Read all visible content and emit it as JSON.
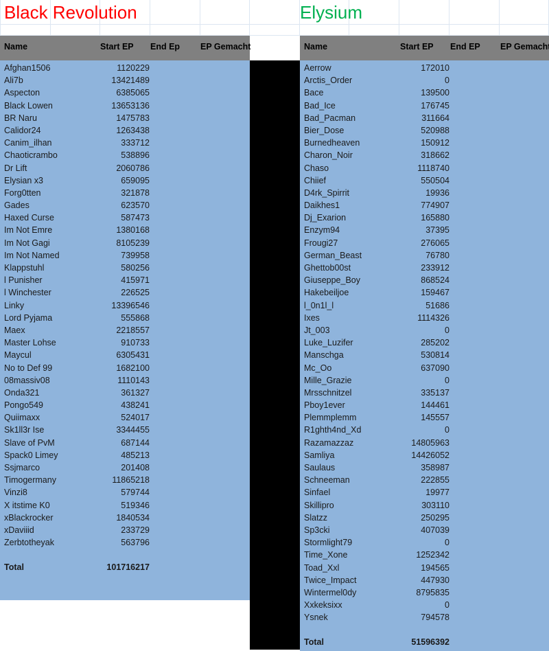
{
  "sheet": {
    "left_table": {
      "title": "Black Revolution",
      "title_color": "#ff0000",
      "columns": {
        "name": "Name",
        "start_ep": "Start EP",
        "end_ep": "End Ep",
        "ep_gemacht": "EP Gemacht"
      },
      "rows": [
        {
          "name": "Afghan1506",
          "start_ep": "1120229",
          "end_ep": "",
          "ep_gemacht": ""
        },
        {
          "name": "Ali7b",
          "start_ep": "13421489",
          "end_ep": "",
          "ep_gemacht": ""
        },
        {
          "name": "Aspecton",
          "start_ep": "6385065",
          "end_ep": "",
          "ep_gemacht": ""
        },
        {
          "name": "Black Lowen",
          "start_ep": "13653136",
          "end_ep": "",
          "ep_gemacht": ""
        },
        {
          "name": "BR Naru",
          "start_ep": "1475783",
          "end_ep": "",
          "ep_gemacht": ""
        },
        {
          "name": "Calidor24",
          "start_ep": "1263438",
          "end_ep": "",
          "ep_gemacht": ""
        },
        {
          "name": "Canim_ilhan",
          "start_ep": "333712",
          "end_ep": "",
          "ep_gemacht": ""
        },
        {
          "name": "Chaoticrambo",
          "start_ep": "538896",
          "end_ep": "",
          "ep_gemacht": ""
        },
        {
          "name": "Dr Lift",
          "start_ep": "2060786",
          "end_ep": "",
          "ep_gemacht": ""
        },
        {
          "name": "Elysian x3",
          "start_ep": "659095",
          "end_ep": "",
          "ep_gemacht": ""
        },
        {
          "name": "Forg0tten",
          "start_ep": "321878",
          "end_ep": "",
          "ep_gemacht": ""
        },
        {
          "name": "Gades",
          "start_ep": "623570",
          "end_ep": "",
          "ep_gemacht": ""
        },
        {
          "name": "Haxed Curse",
          "start_ep": "587473",
          "end_ep": "",
          "ep_gemacht": ""
        },
        {
          "name": "Im Not Emre",
          "start_ep": "1380168",
          "end_ep": "",
          "ep_gemacht": ""
        },
        {
          "name": "Im Not Gagi",
          "start_ep": "8105239",
          "end_ep": "",
          "ep_gemacht": ""
        },
        {
          "name": "Im Not Named",
          "start_ep": "739958",
          "end_ep": "",
          "ep_gemacht": ""
        },
        {
          "name": "Klappstuhl",
          "start_ep": "580256",
          "end_ep": "",
          "ep_gemacht": ""
        },
        {
          "name": "l Punisher",
          "start_ep": "415971",
          "end_ep": "",
          "ep_gemacht": ""
        },
        {
          "name": "l Winchester",
          "start_ep": "226525",
          "end_ep": "",
          "ep_gemacht": ""
        },
        {
          "name": "Linky",
          "start_ep": "13396546",
          "end_ep": "",
          "ep_gemacht": ""
        },
        {
          "name": "Lord Pyjama",
          "start_ep": "555868",
          "end_ep": "",
          "ep_gemacht": ""
        },
        {
          "name": "Maex",
          "start_ep": "2218557",
          "end_ep": "",
          "ep_gemacht": ""
        },
        {
          "name": "Master Lohse",
          "start_ep": "910733",
          "end_ep": "",
          "ep_gemacht": ""
        },
        {
          "name": "Maycul",
          "start_ep": "6305431",
          "end_ep": "",
          "ep_gemacht": ""
        },
        {
          "name": "No to Def 99",
          "start_ep": "1682100",
          "end_ep": "",
          "ep_gemacht": ""
        },
        {
          "name": "08massiv08",
          "start_ep": "1110143",
          "end_ep": "",
          "ep_gemacht": ""
        },
        {
          "name": "Onda321",
          "start_ep": "361327",
          "end_ep": "",
          "ep_gemacht": ""
        },
        {
          "name": "Pongo549",
          "start_ep": "438241",
          "end_ep": "",
          "ep_gemacht": ""
        },
        {
          "name": "Quiimaxx",
          "start_ep": "524017",
          "end_ep": "",
          "ep_gemacht": ""
        },
        {
          "name": "Sk1ll3r Ise",
          "start_ep": "3344455",
          "end_ep": "",
          "ep_gemacht": ""
        },
        {
          "name": "Slave of PvM",
          "start_ep": "687144",
          "end_ep": "",
          "ep_gemacht": ""
        },
        {
          "name": "Spack0 Limey",
          "start_ep": "485213",
          "end_ep": "",
          "ep_gemacht": ""
        },
        {
          "name": "Ssjmarco",
          "start_ep": "201408",
          "end_ep": "",
          "ep_gemacht": ""
        },
        {
          "name": "Timogermany",
          "start_ep": "11865218",
          "end_ep": "",
          "ep_gemacht": ""
        },
        {
          "name": "Vinzi8",
          "start_ep": "579744",
          "end_ep": "",
          "ep_gemacht": ""
        },
        {
          "name": "X itstime K0",
          "start_ep": "519346",
          "end_ep": "",
          "ep_gemacht": ""
        },
        {
          "name": "xBlackrocker",
          "start_ep": "1840534",
          "end_ep": "",
          "ep_gemacht": ""
        },
        {
          "name": "xDaviiid",
          "start_ep": "233729",
          "end_ep": "",
          "ep_gemacht": ""
        },
        {
          "name": "Zerbtotheyak",
          "start_ep": "563796",
          "end_ep": "",
          "ep_gemacht": ""
        }
      ],
      "total": {
        "name": "Total",
        "start_ep": "101716217",
        "end_ep": "",
        "ep_gemacht": ""
      }
    },
    "right_table": {
      "title": "Elysium",
      "title_color": "#00b050",
      "columns": {
        "name": "Name",
        "start_ep": "Start EP",
        "end_ep": "End EP",
        "ep_gemacht": "EP Gemacht"
      },
      "rows": [
        {
          "name": "Aerrow",
          "start_ep": "172010",
          "end_ep": "",
          "ep_gemacht": ""
        },
        {
          "name": "Arctis_Order",
          "start_ep": "0",
          "end_ep": "",
          "ep_gemacht": ""
        },
        {
          "name": "Bace",
          "start_ep": "139500",
          "end_ep": "",
          "ep_gemacht": ""
        },
        {
          "name": "Bad_Ice",
          "start_ep": "176745",
          "end_ep": "",
          "ep_gemacht": ""
        },
        {
          "name": "Bad_Pacman",
          "start_ep": "311664",
          "end_ep": "",
          "ep_gemacht": ""
        },
        {
          "name": "Bier_Dose",
          "start_ep": "520988",
          "end_ep": "",
          "ep_gemacht": ""
        },
        {
          "name": "Burnedheaven",
          "start_ep": "150912",
          "end_ep": "",
          "ep_gemacht": ""
        },
        {
          "name": "Charon_Noir",
          "start_ep": "318662",
          "end_ep": "",
          "ep_gemacht": ""
        },
        {
          "name": "Chaso",
          "start_ep": "1118740",
          "end_ep": "",
          "ep_gemacht": ""
        },
        {
          "name": "Chiief",
          "start_ep": "550504",
          "end_ep": "",
          "ep_gemacht": ""
        },
        {
          "name": "D4rk_Spirrit",
          "start_ep": "19936",
          "end_ep": "",
          "ep_gemacht": ""
        },
        {
          "name": "Daikhes1",
          "start_ep": "774907",
          "end_ep": "",
          "ep_gemacht": ""
        },
        {
          "name": "Dj_Exarion",
          "start_ep": "165880",
          "end_ep": "",
          "ep_gemacht": ""
        },
        {
          "name": "Enzym94",
          "start_ep": "37395",
          "end_ep": "",
          "ep_gemacht": ""
        },
        {
          "name": "Frougi27",
          "start_ep": "276065",
          "end_ep": "",
          "ep_gemacht": ""
        },
        {
          "name": "German_Beast",
          "start_ep": "76780",
          "end_ep": "",
          "ep_gemacht": ""
        },
        {
          "name": "Ghettob00st",
          "start_ep": "233912",
          "end_ep": "",
          "ep_gemacht": ""
        },
        {
          "name": "Giuseppe_Boy",
          "start_ep": "868524",
          "end_ep": "",
          "ep_gemacht": ""
        },
        {
          "name": "Hakebeiljoe",
          "start_ep": "159467",
          "end_ep": "",
          "ep_gemacht": ""
        },
        {
          "name": "l_0n1l_l",
          "start_ep": "51686",
          "end_ep": "",
          "ep_gemacht": ""
        },
        {
          "name": "Ixes",
          "start_ep": "1114326",
          "end_ep": "",
          "ep_gemacht": ""
        },
        {
          "name": "Jt_003",
          "start_ep": "0",
          "end_ep": "",
          "ep_gemacht": ""
        },
        {
          "name": "Luke_Luzifer",
          "start_ep": "285202",
          "end_ep": "",
          "ep_gemacht": ""
        },
        {
          "name": "Manschga",
          "start_ep": "530814",
          "end_ep": "",
          "ep_gemacht": ""
        },
        {
          "name": "Mc_Oo",
          "start_ep": "637090",
          "end_ep": "",
          "ep_gemacht": ""
        },
        {
          "name": "Mille_Grazie",
          "start_ep": "0",
          "end_ep": "",
          "ep_gemacht": ""
        },
        {
          "name": "Mrsschnitzel",
          "start_ep": "335137",
          "end_ep": "",
          "ep_gemacht": ""
        },
        {
          "name": "Pboy1ever",
          "start_ep": "144461",
          "end_ep": "",
          "ep_gemacht": ""
        },
        {
          "name": "Plemmplemm",
          "start_ep": "145557",
          "end_ep": "",
          "ep_gemacht": ""
        },
        {
          "name": "R1ghth4nd_Xd",
          "start_ep": "0",
          "end_ep": "",
          "ep_gemacht": ""
        },
        {
          "name": "Razamazzaz",
          "start_ep": "14805963",
          "end_ep": "",
          "ep_gemacht": ""
        },
        {
          "name": "Samliya",
          "start_ep": "14426052",
          "end_ep": "",
          "ep_gemacht": ""
        },
        {
          "name": "Saulaus",
          "start_ep": "358987",
          "end_ep": "",
          "ep_gemacht": ""
        },
        {
          "name": "Schneeman",
          "start_ep": "222855",
          "end_ep": "",
          "ep_gemacht": ""
        },
        {
          "name": "Sinfael",
          "start_ep": "19977",
          "end_ep": "",
          "ep_gemacht": ""
        },
        {
          "name": "Skillipro",
          "start_ep": "303110",
          "end_ep": "",
          "ep_gemacht": ""
        },
        {
          "name": "Slatzz",
          "start_ep": "250295",
          "end_ep": "",
          "ep_gemacht": ""
        },
        {
          "name": "Sp3cki",
          "start_ep": "407039",
          "end_ep": "",
          "ep_gemacht": ""
        },
        {
          "name": "Stormlight79",
          "start_ep": "0",
          "end_ep": "",
          "ep_gemacht": ""
        },
        {
          "name": "Time_Xone",
          "start_ep": "1252342",
          "end_ep": "",
          "ep_gemacht": ""
        },
        {
          "name": "Toad_Xxl",
          "start_ep": "194565",
          "end_ep": "",
          "ep_gemacht": ""
        },
        {
          "name": "Twice_Impact",
          "start_ep": "447930",
          "end_ep": "",
          "ep_gemacht": ""
        },
        {
          "name": "Wintermel0dy",
          "start_ep": "8795835",
          "end_ep": "",
          "ep_gemacht": ""
        },
        {
          "name": "Xxkeksixx",
          "start_ep": "0",
          "end_ep": "",
          "ep_gemacht": ""
        },
        {
          "name": "Ysnek",
          "start_ep": "794578",
          "end_ep": "",
          "ep_gemacht": ""
        }
      ],
      "total": {
        "name": "Total",
        "start_ep": "51596392",
        "end_ep": "",
        "ep_gemacht": ""
      }
    },
    "colors": {
      "header_gray": "#808080",
      "row_blue": "#8fb4dc",
      "separator_black": "#000000",
      "gridline": "#dce6f1"
    }
  }
}
